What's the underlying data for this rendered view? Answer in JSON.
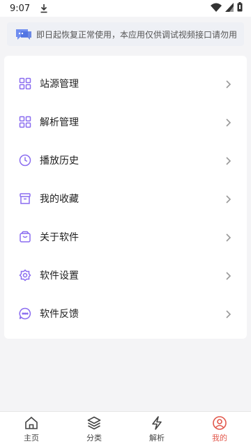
{
  "status_bar": {
    "time": "9:07",
    "icons": [
      "download-icon",
      "wifi-icon",
      "signal-icon",
      "battery-icon"
    ]
  },
  "notice": {
    "icon": "message-icon",
    "text": "即日起恢复正常使用，本应用仅供调试视频接口请勿用"
  },
  "menu": {
    "items": [
      {
        "label": "站源管理",
        "icon": "grid-icon"
      },
      {
        "label": "解析管理",
        "icon": "grid-icon"
      },
      {
        "label": "播放历史",
        "icon": "clock-icon"
      },
      {
        "label": "我的收藏",
        "icon": "archive-icon"
      },
      {
        "label": "关于软件",
        "icon": "bag-icon"
      },
      {
        "label": "软件设置",
        "icon": "settings-icon"
      },
      {
        "label": "软件反馈",
        "icon": "chat-icon"
      }
    ]
  },
  "tabbar": {
    "active": "我的",
    "tabs": [
      {
        "label": "主页",
        "icon": "home-icon"
      },
      {
        "label": "分类",
        "icon": "layers-icon"
      },
      {
        "label": "解析",
        "icon": "lightning-icon"
      },
      {
        "label": "我的",
        "icon": "user-icon"
      }
    ]
  },
  "colors": {
    "accent": "#8a6cf0",
    "active_tab": "#e2584c",
    "background": "#f4f4f6"
  }
}
